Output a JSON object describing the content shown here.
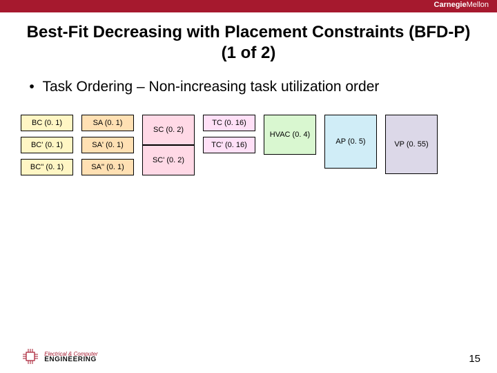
{
  "brand": {
    "carnegie": "Carnegie",
    "mellon": "Mellon"
  },
  "title": "Best-Fit Decreasing with Placement Constraints (BFD-P) (1 of 2)",
  "bullet": "Task Ordering – Non-increasing task utilization order",
  "cols": {
    "c1": [
      "BC (0. 1)",
      "BC' (0. 1)",
      "BC'' (0. 1)"
    ],
    "c2": [
      "SA (0. 1)",
      "SA' (0. 1)",
      "SA'' (0. 1)"
    ],
    "c3": [
      "SC (0. 2)",
      "SC' (0. 2)"
    ],
    "c4": [
      "TC (0. 16)",
      "TC' (0. 16)"
    ],
    "c5": [
      "HVAC (0. 4)"
    ],
    "c6": [
      "AP (0. 5)"
    ],
    "c7": [
      "VP (0. 55)"
    ]
  },
  "footer": {
    "dept_top": "Electrical",
    "dept_amp": "&",
    "dept_top2": "Computer",
    "dept_bottom": "ENGINEERING",
    "pagenum": "15"
  }
}
